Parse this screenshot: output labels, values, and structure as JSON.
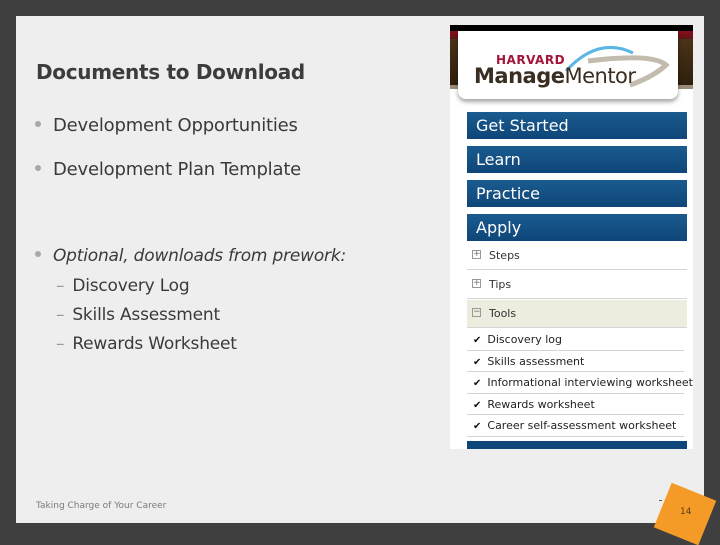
{
  "slide": {
    "title": "Documents to Download",
    "bullets": [
      "Development Opportunities",
      "Development Plan Template"
    ],
    "optional_heading": "Optional, downloads from prework:",
    "optional_items": [
      "Discovery Log",
      "Skills Assessment",
      "Rewards Worksheet"
    ],
    "footer": "Taking Charge of Your Career",
    "page_number": "14",
    "accent_color": "#f39b26"
  },
  "screenshot": {
    "logo": {
      "line1": "HARVARD",
      "line2_bold": "Manage",
      "line2_regular": "Mentor"
    },
    "nav": [
      "Get Started",
      "Learn",
      "Practice",
      "Apply"
    ],
    "sections": [
      {
        "label": "Steps",
        "icon": "plus-box-icon"
      },
      {
        "label": "Tips",
        "icon": "plus-box-icon"
      },
      {
        "label": "Tools",
        "icon": "minus-box-icon"
      }
    ],
    "tools": [
      "Discovery log",
      "Skills assessment",
      "Informational interviewing worksheet",
      "Rewards worksheet",
      "Career self-assessment worksheet"
    ],
    "nav_color": "#0f4679"
  }
}
